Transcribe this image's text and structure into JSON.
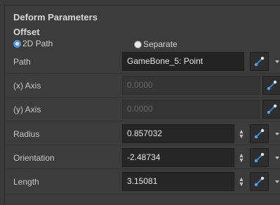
{
  "panel": {
    "title": "Deform Parameters",
    "offset_label": "Offset"
  },
  "offset_mode": {
    "path_option": "2D Path",
    "separate_option": "Separate",
    "selected": "2D Path"
  },
  "fields": {
    "path": {
      "label": "Path",
      "value": "GameBone_5: Point"
    },
    "x_axis": {
      "label": "(x) Axis",
      "value": "0.0000"
    },
    "y_axis": {
      "label": "(y) Axis",
      "value": "0.0000"
    },
    "radius": {
      "label": "Radius",
      "value": "0.857032"
    },
    "orientation": {
      "label": "Orientation",
      "value": "-2.48734"
    },
    "length": {
      "label": "Length",
      "value": "3.15081"
    }
  },
  "icons": {
    "link": "function-link-icon",
    "spinner": "spin-arrows-icon",
    "menu": "dropdown-arrow-icon"
  },
  "colors": {
    "accent": "#4a90e2",
    "panel_bg": "#3c3c3c",
    "field_bg": "#262626"
  }
}
